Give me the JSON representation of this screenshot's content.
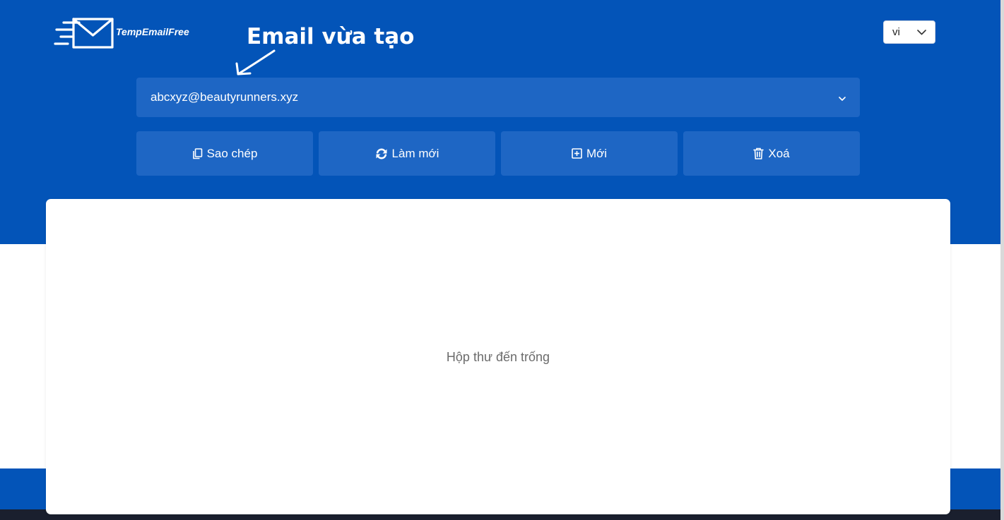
{
  "brand": {
    "name": "TempEmailFree",
    "icon": "envelope-speed-icon"
  },
  "annotation": {
    "text": "Email vừa tạo"
  },
  "language": {
    "selected": "vi"
  },
  "email": {
    "value": "abcxyz@beautyrunners.xyz"
  },
  "actions": [
    {
      "label": "Sao chép",
      "icon": "copy-icon"
    },
    {
      "label": "Làm mới",
      "icon": "refresh-icon"
    },
    {
      "label": "Mới",
      "icon": "plus-square-icon"
    },
    {
      "label": "Xoá",
      "icon": "trash-icon"
    }
  ],
  "inbox": {
    "empty_text": "Hộp thư đến trống"
  },
  "colors": {
    "primary": "#0354b8",
    "button": "#1e66c4",
    "footer": "#1a1f2e"
  }
}
